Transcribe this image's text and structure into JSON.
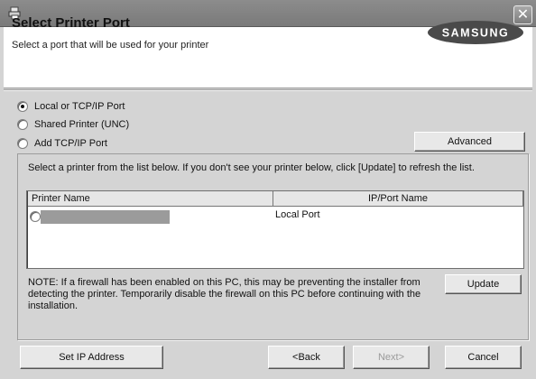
{
  "window": {
    "app_icon": "printer-setup-icon",
    "close_glyph": "✕"
  },
  "header": {
    "title": "Select Printer Port",
    "subtitle": "Select a port that will be used for your printer",
    "logo_text": "SAMSUNG"
  },
  "port_options": [
    {
      "label": "Local or TCP/IP Port",
      "selected": true
    },
    {
      "label": "Shared Printer (UNC)",
      "selected": false
    },
    {
      "label": "Add TCP/IP Port",
      "selected": false
    }
  ],
  "buttons": {
    "advanced": "Advanced",
    "update": "Update",
    "set_ip": "Set IP Address",
    "back": "<Back",
    "next": "Next>",
    "cancel": "Cancel"
  },
  "instruction": "Select a printer from the list below. If you don't see your printer below, click [Update] to refresh the list.",
  "printer_list": {
    "columns": [
      "Printer Name",
      "IP/Port Name"
    ],
    "rows": [
      {
        "printer_name": "",
        "port_name": "Local Port",
        "selected": false
      }
    ]
  },
  "note_lines": [
    "NOTE: If a firewall has been enabled on this PC, this may be preventing the installer from",
    "detecting the printer. Temporarily disable the firewall on this PC before continuing with the",
    "installation."
  ]
}
